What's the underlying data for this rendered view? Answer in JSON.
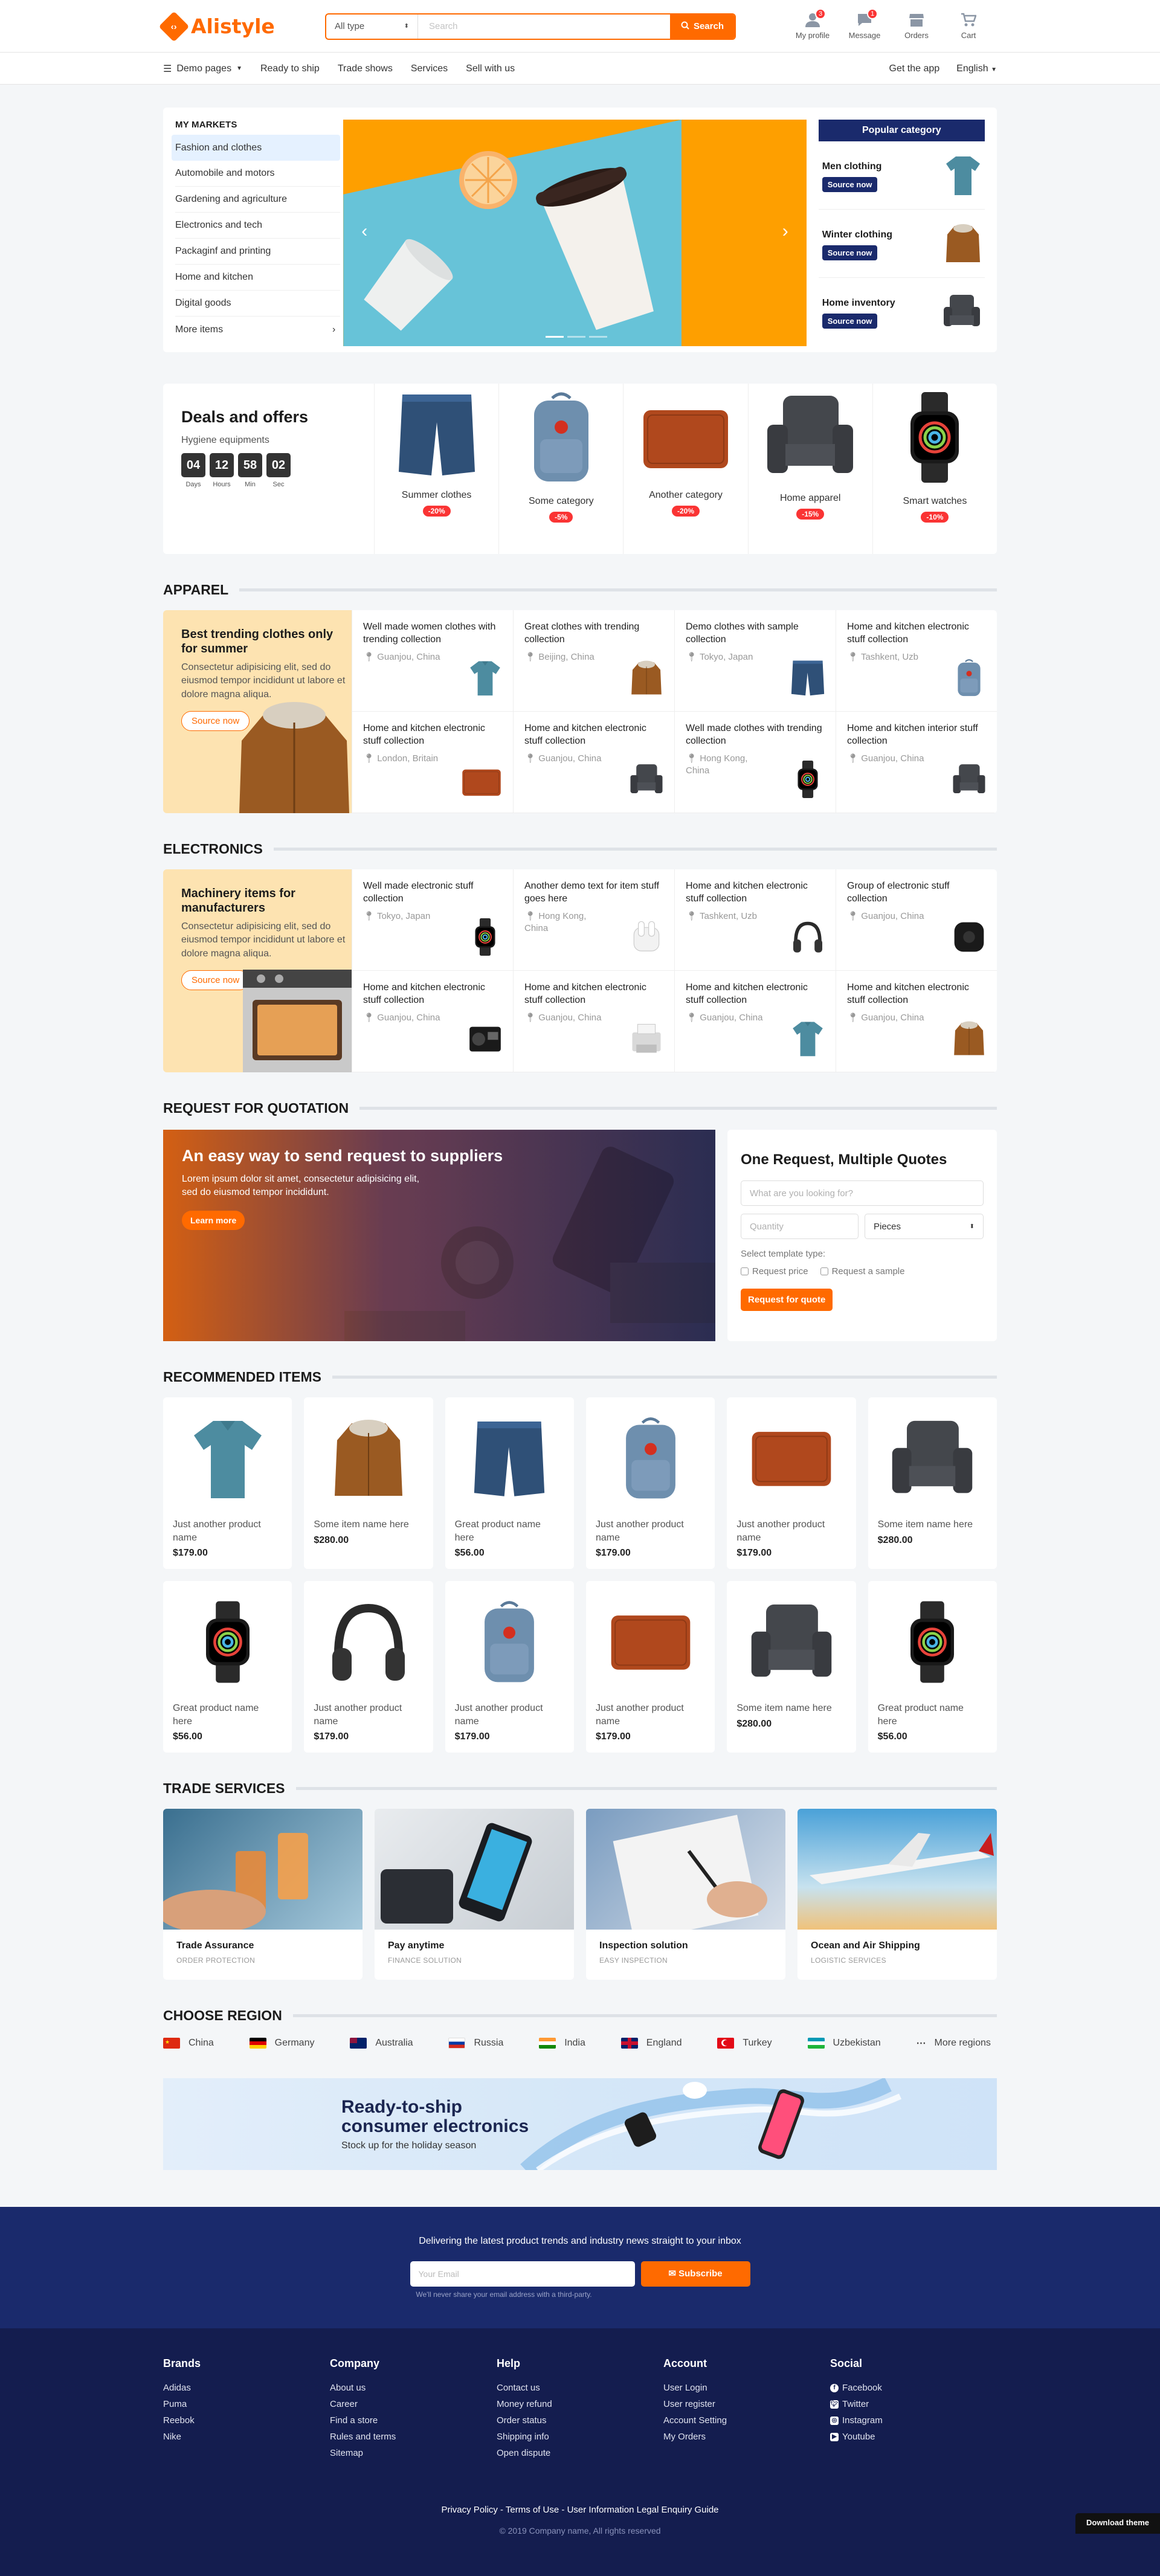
{
  "header": {
    "logo": "Alistyle",
    "search_type": "All type",
    "search_placeholder": "Search",
    "search_button": "Search",
    "icons": [
      {
        "label": "My profile",
        "badge": "3"
      },
      {
        "label": "Message",
        "badge": "1"
      },
      {
        "label": "Orders",
        "badge": ""
      },
      {
        "label": "Cart",
        "badge": ""
      }
    ]
  },
  "subnav": {
    "items": [
      "Demo pages",
      "Ready to ship",
      "Trade shows",
      "Services",
      "Sell with us"
    ],
    "app": "Get the app",
    "lang": "English"
  },
  "markets": {
    "title": "MY MARKETS",
    "items": [
      "Fashion and clothes",
      "Automobile and motors",
      "Gardening and agriculture",
      "Electronics and tech",
      "Packaginf and printing",
      "Home and kitchen",
      "Digital goods",
      "More items"
    ]
  },
  "popular": {
    "title": "Popular category",
    "items": [
      {
        "name": "Men clothing",
        "btn": "Source now"
      },
      {
        "name": "Winter clothing",
        "btn": "Source now"
      },
      {
        "name": "Home inventory",
        "btn": "Source now"
      }
    ]
  },
  "deals": {
    "title": "Deals and offers",
    "subtitle": "Hygiene equipments",
    "timer": [
      {
        "v": "04",
        "l": "Days"
      },
      {
        "v": "12",
        "l": "Hours"
      },
      {
        "v": "58",
        "l": "Min"
      },
      {
        "v": "02",
        "l": "Sec"
      }
    ],
    "items": [
      {
        "name": "Summer clothes",
        "pct": "-20%"
      },
      {
        "name": "Some category",
        "pct": "-5%"
      },
      {
        "name": "Another category",
        "pct": "-20%"
      },
      {
        "name": "Home apparel",
        "pct": "-15%"
      },
      {
        "name": "Smart watches",
        "pct": "-10%"
      }
    ]
  },
  "apparel": {
    "heading": "APPAREL",
    "title": "Best trending clothes only for summer",
    "text": "Consectetur adipisicing elit, sed do eiusmod tempor incididunt ut labore et dolore magna aliqua.",
    "btn": "Source now",
    "cells": [
      {
        "t": "Well made women clothes with trending collection",
        "l": "Guanjou, China"
      },
      {
        "t": "Great clothes with trending collection",
        "l": "Beijing, China"
      },
      {
        "t": "Demo clothes with sample collection",
        "l": "Tokyo, Japan"
      },
      {
        "t": "Home and kitchen electronic stuff collection",
        "l": "Tashkent, Uzb"
      },
      {
        "t": "Home and kitchen electronic stuff collection",
        "l": "London, Britain"
      },
      {
        "t": "Home and kitchen electronic stuff collection",
        "l": "Guanjou, China"
      },
      {
        "t": "Well made clothes with trending collection",
        "l": "Hong Kong, China"
      },
      {
        "t": "Home and kitchen interior stuff collection",
        "l": "Guanjou, China"
      }
    ]
  },
  "electronics": {
    "heading": "ELECTRONICS",
    "title": "Machinery items for manufacturers",
    "text": "Consectetur adipisicing elit, sed do eiusmod tempor incididunt ut labore et dolore magna aliqua.",
    "btn": "Source now",
    "cells": [
      {
        "t": "Well made electronic stuff collection",
        "l": "Tokyo, Japan"
      },
      {
        "t": "Another demo text for item stuff goes here",
        "l": "Hong Kong, China"
      },
      {
        "t": "Home and kitchen electronic stuff collection",
        "l": "Tashkent, Uzb"
      },
      {
        "t": "Group of electronic stuff collection",
        "l": "Guanjou, China"
      },
      {
        "t": "Home and kitchen electronic stuff collection",
        "l": "Guanjou, China"
      },
      {
        "t": "Home and kitchen electronic stuff collection",
        "l": "Guanjou, China"
      },
      {
        "t": "Home and kitchen electronic stuff collection",
        "l": "Guanjou, China"
      },
      {
        "t": "Home and kitchen electronic stuff collection",
        "l": "Guanjou, China"
      }
    ]
  },
  "quote": {
    "heading": "REQUEST FOR QUOTATION",
    "banner_title": "An easy way to send request to suppliers",
    "banner_text": "Lorem ipsum dolor sit amet, consectetur adipisicing elit, sed do eiusmod tempor incididunt.",
    "banner_btn": "Learn more",
    "form_title": "One Request, Multiple Quotes",
    "what_placeholder": "What are you looking for?",
    "qty_placeholder": "Quantity",
    "unit": "Pieces",
    "template_label": "Select template type:",
    "opt1": "Request price",
    "opt2": "Request a sample",
    "submit": "Request for quote"
  },
  "recommended": {
    "heading": "RECOMMENDED ITEMS",
    "items": [
      {
        "n": "Just another product name",
        "p": "$179.00",
        "i": "shirt"
      },
      {
        "n": "Some item name here",
        "p": "$280.00",
        "i": "jacket"
      },
      {
        "n": "Great product name here",
        "p": "$56.00",
        "i": "shorts"
      },
      {
        "n": "Just another product name",
        "p": "$179.00",
        "i": "backpack"
      },
      {
        "n": "Just another product name",
        "p": "$179.00",
        "i": "wallet"
      },
      {
        "n": "Some item name here",
        "p": "$280.00",
        "i": "chair"
      },
      {
        "n": "Great product name here",
        "p": "$56.00",
        "i": "watch"
      },
      {
        "n": "Just another product name",
        "p": "$179.00",
        "i": "headphones"
      },
      {
        "n": "Just another product name",
        "p": "$179.00",
        "i": "backpack"
      },
      {
        "n": "Just another product name",
        "p": "$179.00",
        "i": "wallet"
      },
      {
        "n": "Some item name here",
        "p": "$280.00",
        "i": "chair"
      },
      {
        "n": "Great product name here",
        "p": "$56.00",
        "i": "watch"
      }
    ]
  },
  "trade": {
    "heading": "TRADE SERVICES",
    "items": [
      {
        "t": "Trade Assurance",
        "s": "ORDER PROTECTION"
      },
      {
        "t": "Pay anytime",
        "s": "FINANCE SOLUTION"
      },
      {
        "t": "Inspection solution",
        "s": "EASY INSPECTION"
      },
      {
        "t": "Ocean and Air Shipping",
        "s": "LOGISTIC SERVICES"
      }
    ]
  },
  "regions": {
    "heading": "CHOOSE REGION",
    "items": [
      "China",
      "Germany",
      "Australia",
      "Russia",
      "India",
      "England",
      "Turkey",
      "Uzbekistan",
      "More regions"
    ]
  },
  "promo": {
    "title1": "Ready-to-ship",
    "title2": "consumer electronics",
    "text": "Stock up for the holiday season"
  },
  "newsletter": {
    "title": "Delivering the latest product trends and industry news straight to your inbox",
    "placeholder": "Your Email",
    "btn": "Subscribe",
    "note": "We'll never share your email address with a third-party."
  },
  "footer": {
    "cols": [
      {
        "h": "Brands",
        "items": [
          "Adidas",
          "Puma",
          "Reebok",
          "Nike"
        ]
      },
      {
        "h": "Company",
        "items": [
          "About us",
          "Career",
          "Find a store",
          "Rules and terms",
          "Sitemap"
        ]
      },
      {
        "h": "Help",
        "items": [
          "Contact us",
          "Money refund",
          "Order status",
          "Shipping info",
          "Open dispute"
        ]
      },
      {
        "h": "Account",
        "items": [
          "User Login",
          "User register",
          "Account Setting",
          "My Orders"
        ]
      },
      {
        "h": "Social",
        "items": [
          "Facebook",
          "Twitter",
          "Instagram",
          "Youtube"
        ]
      }
    ],
    "links": "Privacy Policy - Terms of Use - User Information Legal Enquiry Guide",
    "copy": "© 2019 Company name, All rights reserved",
    "download": "Download theme"
  }
}
